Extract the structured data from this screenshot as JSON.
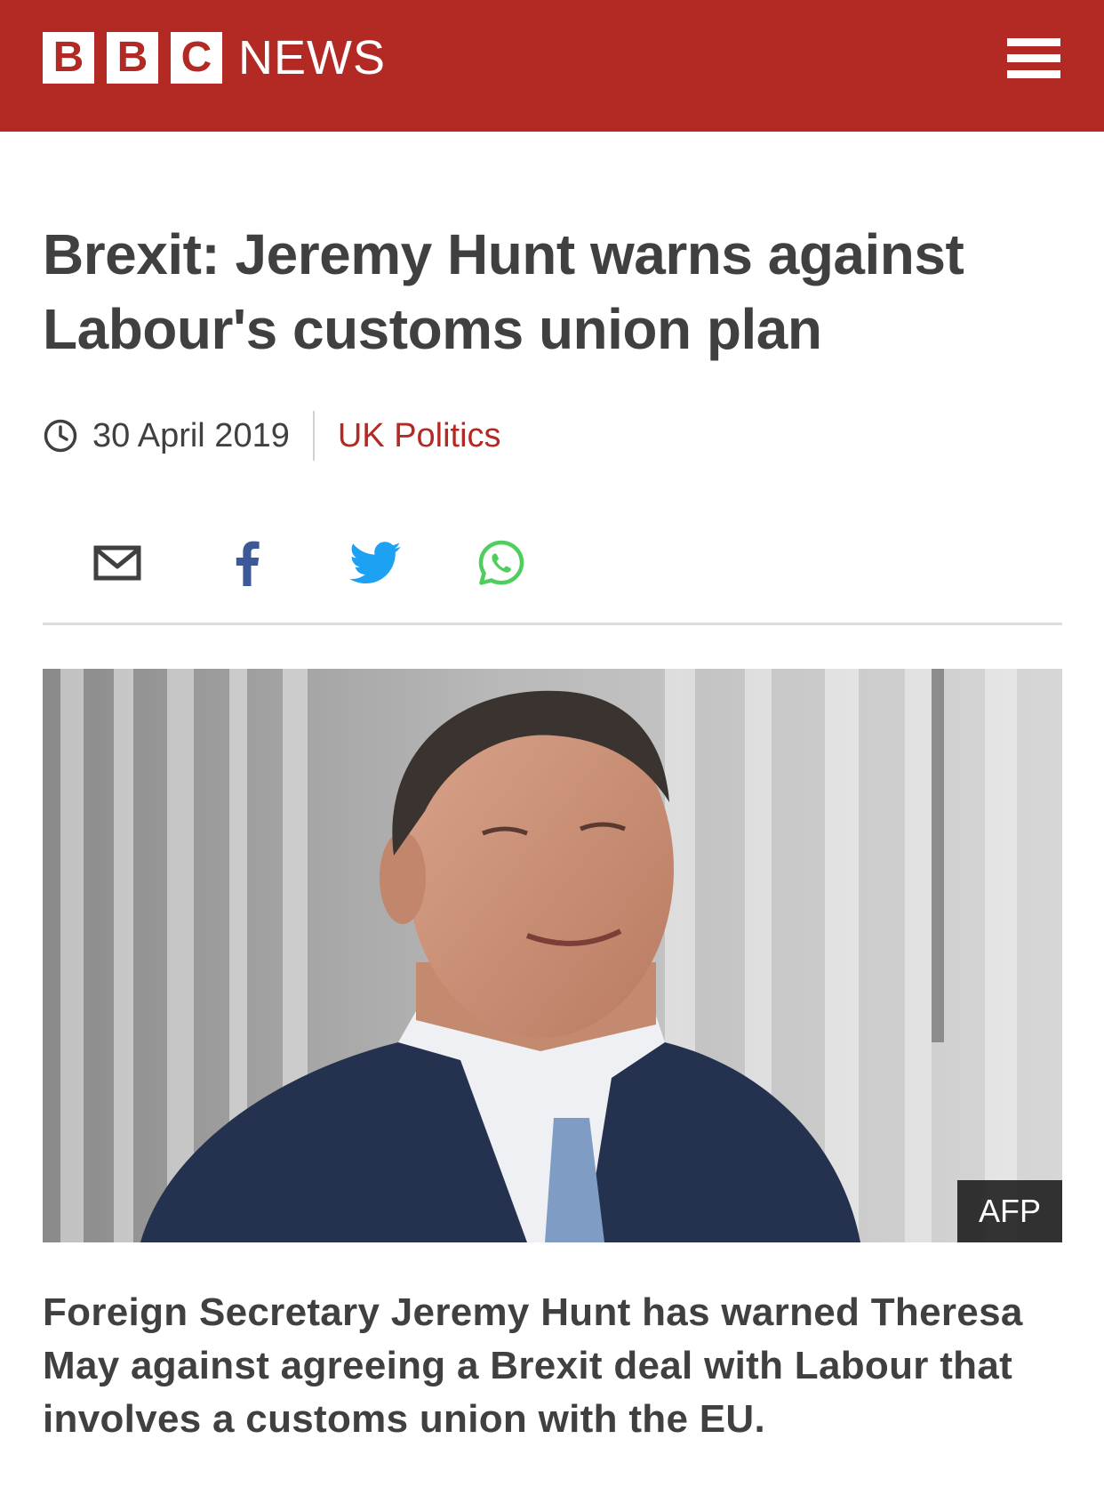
{
  "colors": {
    "brand": "#b32a25",
    "twitter": "#1da1f2",
    "whatsapp": "#4fce5d",
    "facebook": "#3b5998"
  },
  "header": {
    "logo_letters": [
      "B",
      "B",
      "C"
    ],
    "logo_text": "NEWS",
    "menu_icon": "hamburger-menu-icon"
  },
  "article": {
    "headline": "Brexit: Jeremy Hunt warns against Labour's customs union plan",
    "date": "30 April 2019",
    "section": "UK Politics",
    "image_credit": "AFP",
    "summary": "Foreign Secretary Jeremy Hunt has warned Theresa May against agreeing a Brexit deal with Labour that involves a customs union with the EU."
  },
  "share": {
    "icons": [
      "email-icon",
      "facebook-icon",
      "twitter-icon",
      "whatsapp-icon"
    ]
  }
}
